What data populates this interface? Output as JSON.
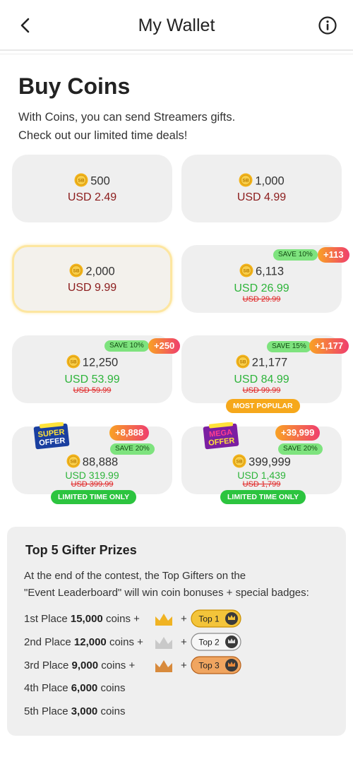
{
  "header": {
    "title": "My Wallet",
    "back_icon": "chevron-left-icon",
    "info_icon": "info-icon"
  },
  "intro": {
    "heading": "Buy Coins",
    "line1": "With Coins, you can send Streamers gifts.",
    "line2": "Check out our limited time deals!"
  },
  "coin_icon": "coin-icon",
  "packages": [
    {
      "coins": "500",
      "price": "USD 2.49"
    },
    {
      "coins": "1,000",
      "price": "USD 4.99"
    },
    {
      "coins": "2,000",
      "price": "USD 9.99"
    },
    {
      "coins": "6,113",
      "price": "USD 26.99",
      "old_price": "USD 29.99",
      "save": "SAVE 10%",
      "bonus": "+113"
    },
    {
      "coins": "12,250",
      "price": "USD 53.99",
      "old_price": "USD 59.99",
      "save": "SAVE 10%",
      "bonus": "+250"
    },
    {
      "coins": "21,177",
      "price": "USD 84.99",
      "old_price": "USD 99.99",
      "save": "SAVE 15%",
      "bonus": "+1,177",
      "tag": "MOST POPULAR"
    },
    {
      "coins": "88,888",
      "price": "USD 319.99",
      "old_price": "USD 399.99",
      "save": "SAVE 20%",
      "bonus": "+8,888",
      "tag": "LIMITED TIME ONLY",
      "offer_line1": "SUPER",
      "offer_line2": "OFFER"
    },
    {
      "coins": "399,999",
      "price": "USD 1,439",
      "old_price": "USD 1,799",
      "save": "SAVE 20%",
      "bonus": "+39,999",
      "tag": "LIMITED TIME ONLY",
      "offer_line1": "MEGA",
      "offer_line2": "OFFER"
    }
  ],
  "prizes": {
    "title": "Top 5 Gifter Prizes",
    "text1": "At the end of the contest, the Top Gifters on the",
    "text2": "\"Event Leaderboard\" will win coin bonuses + special badges:",
    "places": [
      {
        "label": "1st Place",
        "amount": "15,000",
        "unit": "coins +",
        "badge": "Top 1"
      },
      {
        "label": "2nd Place",
        "amount": "12,000",
        "unit": "coins +",
        "badge": "Top 2"
      },
      {
        "label": "3rd Place",
        "amount": "9,000",
        "unit": "coins +",
        "badge": "Top 3"
      },
      {
        "label": "4th Place",
        "amount": "6,000",
        "unit": "coins"
      },
      {
        "label": "5th Place",
        "amount": "3,000",
        "unit": "coins"
      }
    ],
    "plus": "+",
    "colors": {
      "gold": "#f0b323",
      "silver": "#c9c9c9",
      "bronze": "#d88a3c"
    }
  }
}
